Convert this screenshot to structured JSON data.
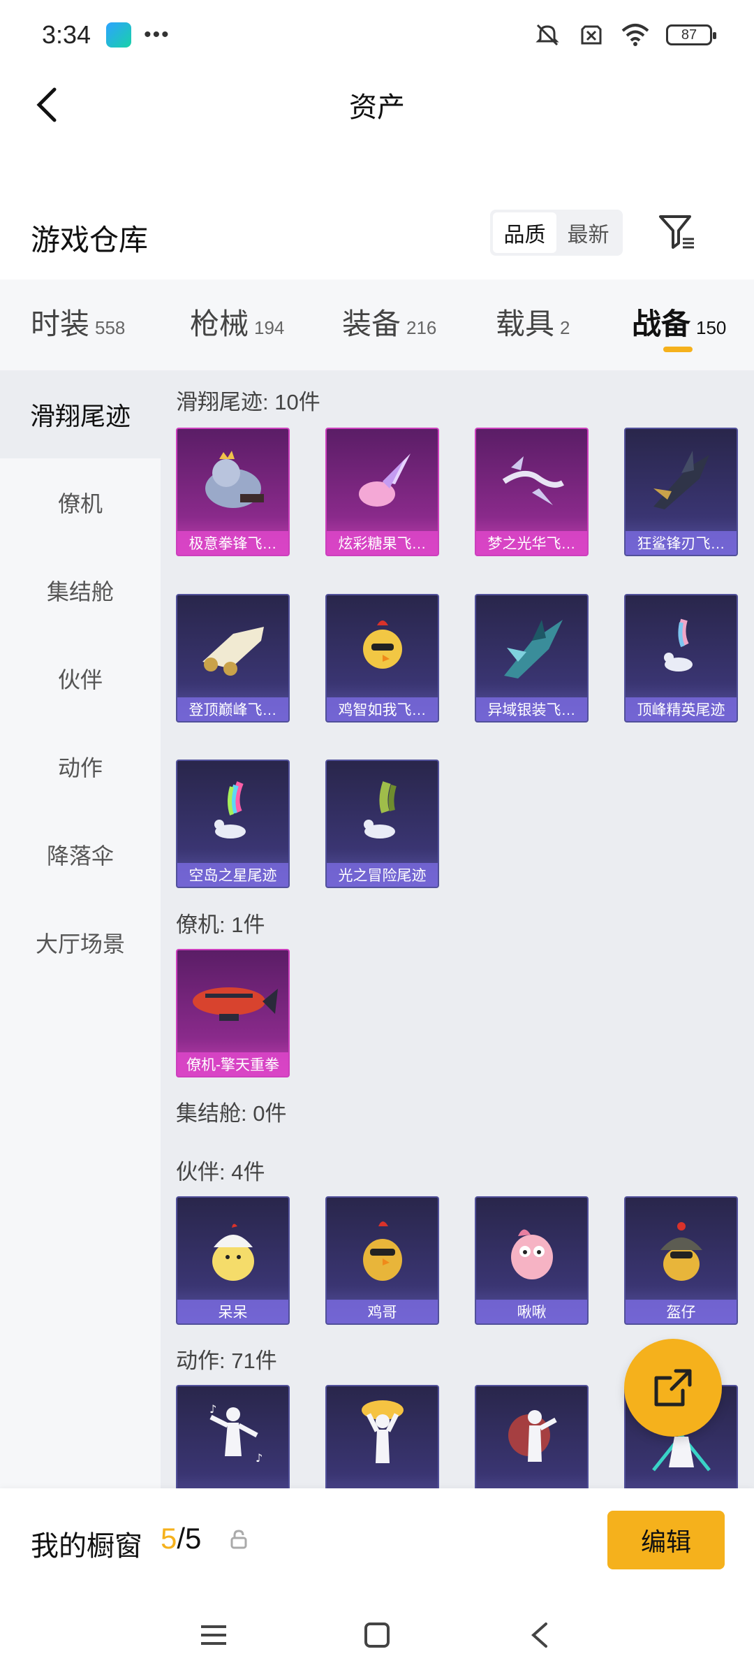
{
  "status": {
    "time": "3:34",
    "battery": "87"
  },
  "header": {
    "title": "资产"
  },
  "warehouse": {
    "title": "游戏仓库",
    "sort_options": [
      "品质",
      "最新"
    ],
    "active_sort": "品质"
  },
  "tabs": [
    {
      "label": "时装",
      "count": "558"
    },
    {
      "label": "枪械",
      "count": "194"
    },
    {
      "label": "装备",
      "count": "216"
    },
    {
      "label": "载具",
      "count": "2"
    },
    {
      "label": "战备",
      "count": "150"
    }
  ],
  "active_tab": "战备",
  "side_nav": [
    "滑翔尾迹",
    "僚机",
    "集结舱",
    "伙伴",
    "动作",
    "降落伞",
    "大厅场景"
  ],
  "active_side": "滑翔尾迹",
  "sections": {
    "trail": {
      "label": "滑翔尾迹: 10件",
      "items": [
        "极意拳锋飞…",
        "炫彩糖果飞…",
        "梦之光华飞…",
        "狂鲨锋刃飞…",
        "登顶巅峰飞…",
        "鸡智如我飞…",
        "异域银装飞…",
        "顶峰精英尾迹",
        "空岛之星尾迹",
        "光之冒险尾迹"
      ]
    },
    "wingman": {
      "label": "僚机: 1件",
      "items": [
        "僚机-擎天重拳"
      ]
    },
    "capsule": {
      "label": "集结舱: 0件"
    },
    "partner": {
      "label": "伙伴: 4件",
      "items": [
        "呆呆",
        "鸡哥",
        "啾啾",
        "盔仔"
      ]
    },
    "emote": {
      "label": "动作: 71件"
    }
  },
  "showcase": {
    "title": "我的橱窗",
    "current": "5",
    "total": "/5",
    "edit_label": "编辑"
  },
  "colors": {
    "accent": "#f5b11c",
    "rare_purple": "#5a55a6",
    "epic_pink": "#c842b3"
  }
}
